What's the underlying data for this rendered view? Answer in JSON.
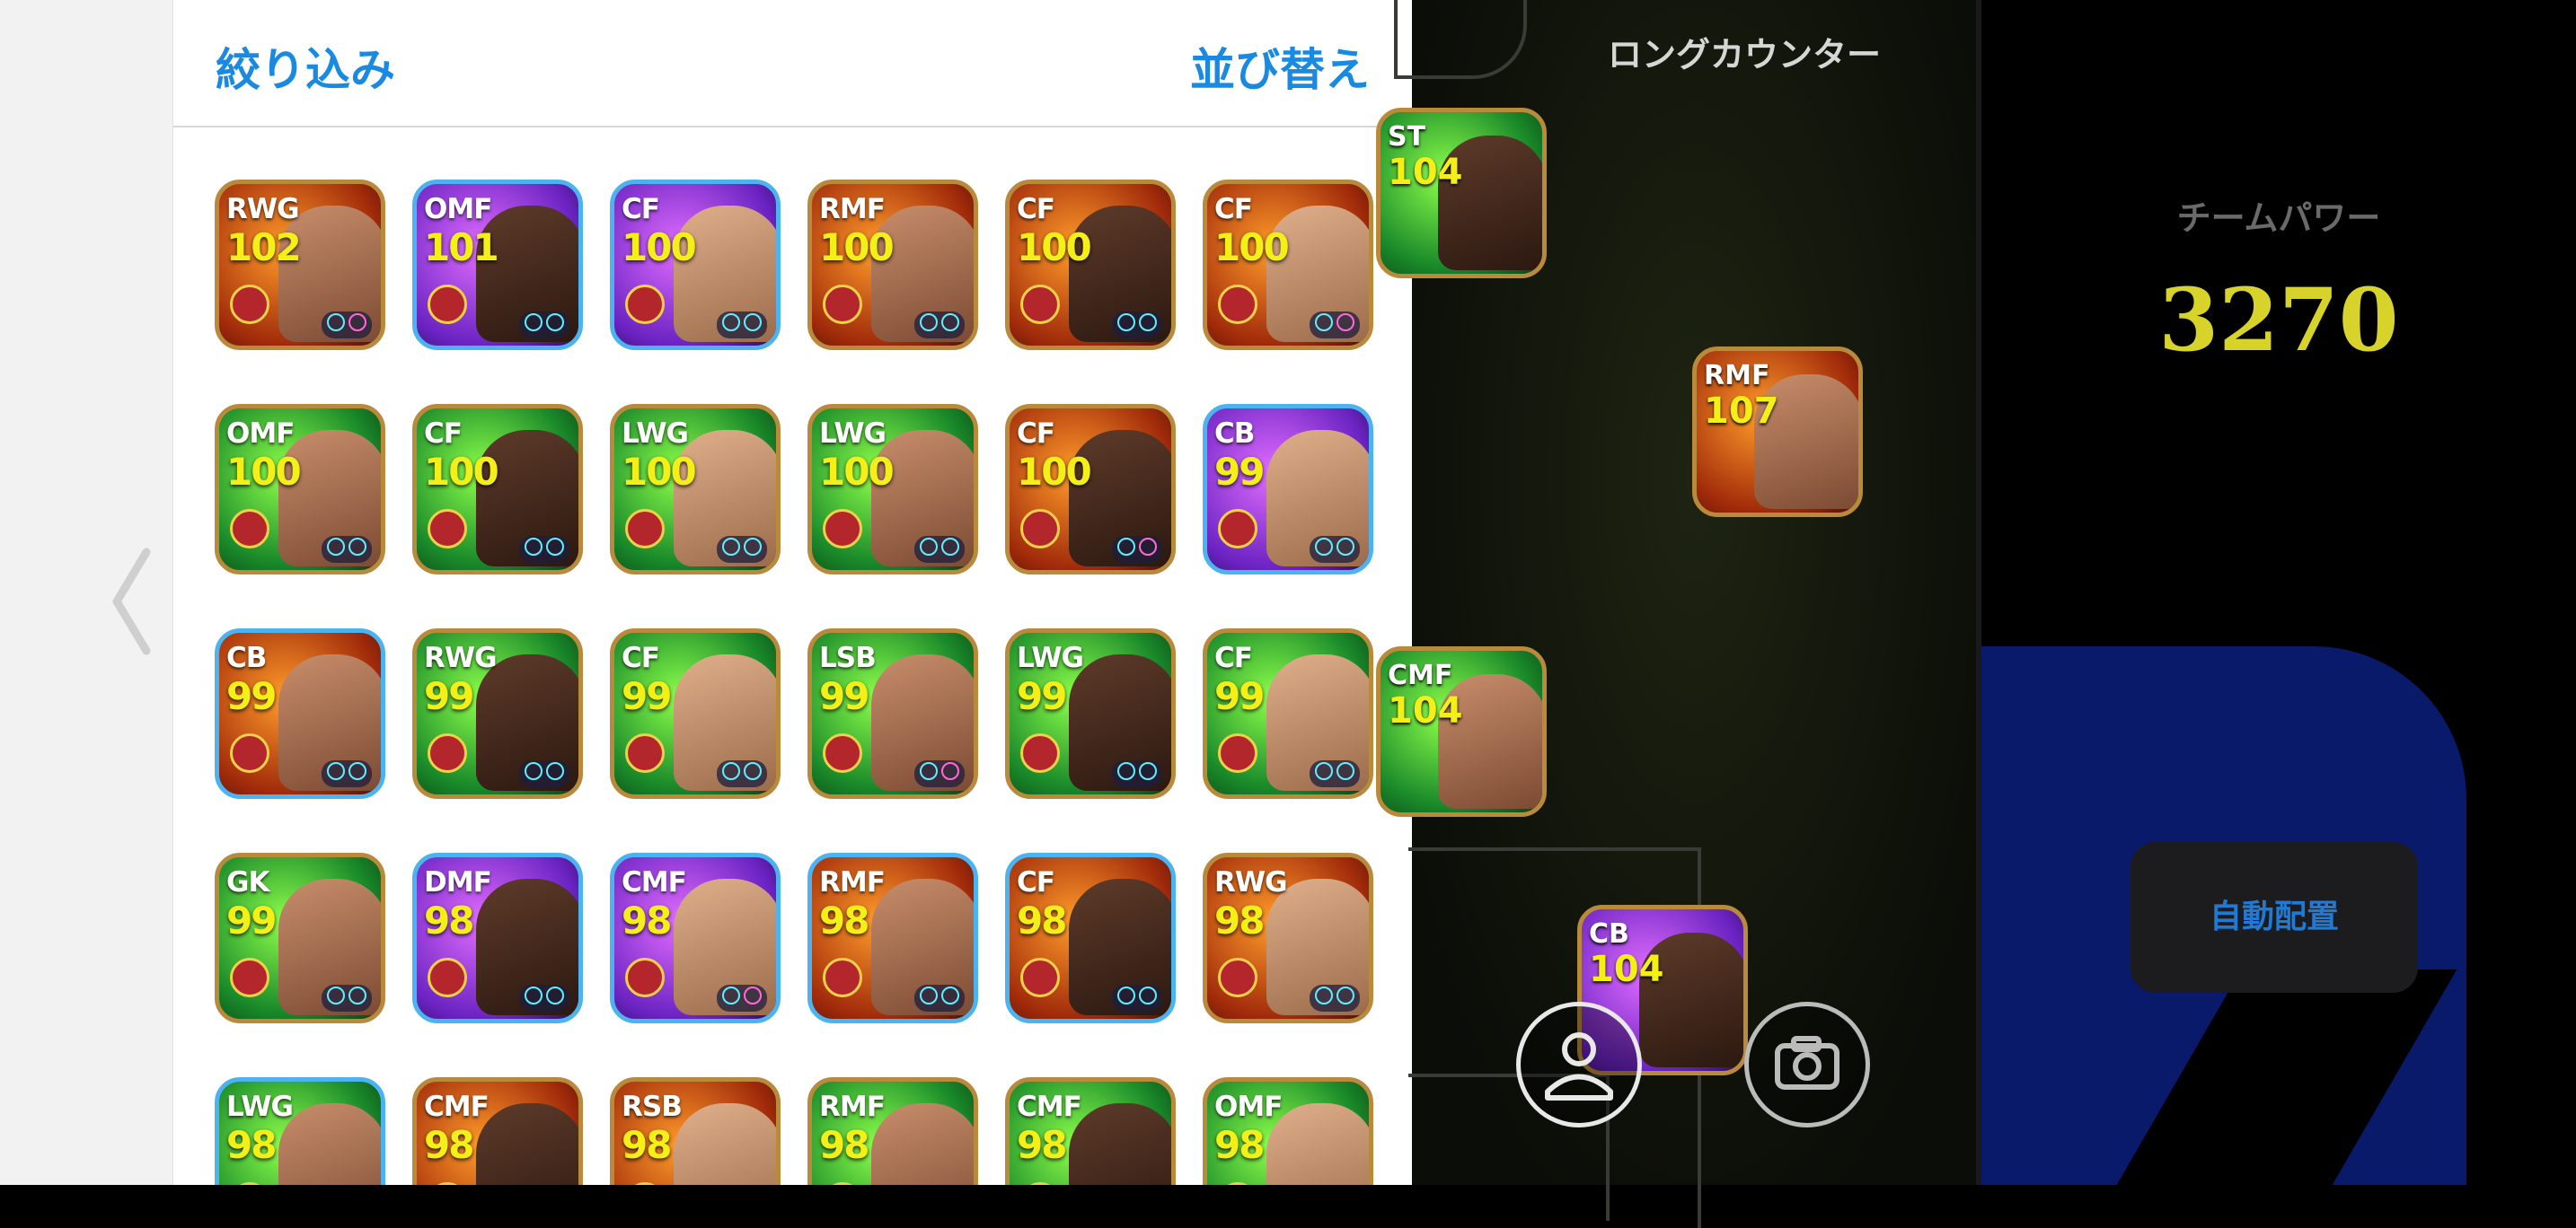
{
  "header": {
    "filter_label": "絞り込み",
    "sort_label": "並び替え"
  },
  "formation": {
    "name": "ロングカウンター"
  },
  "team_power": {
    "label": "チームパワー",
    "value": "3270"
  },
  "auto_assign_label": "自動配置",
  "colors": {
    "accent": "#1a8ae0",
    "rating": "#f4ef16",
    "team_power": "#d7d32a"
  },
  "player_cards": [
    {
      "position": "RWG",
      "rating": "102",
      "bg": "orange",
      "border": "gold"
    },
    {
      "position": "OMF",
      "rating": "101",
      "bg": "purple",
      "border": "blue"
    },
    {
      "position": "CF",
      "rating": "100",
      "bg": "purple",
      "border": "blue"
    },
    {
      "position": "RMF",
      "rating": "100",
      "bg": "orange",
      "border": "gold"
    },
    {
      "position": "CF",
      "rating": "100",
      "bg": "orange",
      "border": "gold"
    },
    {
      "position": "CF",
      "rating": "100",
      "bg": "orange",
      "border": "gold"
    },
    {
      "position": "OMF",
      "rating": "100",
      "bg": "green",
      "border": "gold"
    },
    {
      "position": "CF",
      "rating": "100",
      "bg": "green",
      "border": "gold"
    },
    {
      "position": "LWG",
      "rating": "100",
      "bg": "green",
      "border": "gold"
    },
    {
      "position": "LWG",
      "rating": "100",
      "bg": "green",
      "border": "gold"
    },
    {
      "position": "CF",
      "rating": "100",
      "bg": "orange",
      "border": "gold"
    },
    {
      "position": "CB",
      "rating": "99",
      "bg": "purple",
      "border": "blue"
    },
    {
      "position": "CB",
      "rating": "99",
      "bg": "orange",
      "border": "blue"
    },
    {
      "position": "RWG",
      "rating": "99",
      "bg": "green",
      "border": "gold"
    },
    {
      "position": "CF",
      "rating": "99",
      "bg": "green",
      "border": "gold"
    },
    {
      "position": "LSB",
      "rating": "99",
      "bg": "green",
      "border": "gold"
    },
    {
      "position": "LWG",
      "rating": "99",
      "bg": "green",
      "border": "gold"
    },
    {
      "position": "CF",
      "rating": "99",
      "bg": "green",
      "border": "gold"
    },
    {
      "position": "GK",
      "rating": "99",
      "bg": "green",
      "border": "gold"
    },
    {
      "position": "DMF",
      "rating": "98",
      "bg": "purple",
      "border": "blue"
    },
    {
      "position": "CMF",
      "rating": "98",
      "bg": "purple",
      "border": "blue"
    },
    {
      "position": "RMF",
      "rating": "98",
      "bg": "orange",
      "border": "blue"
    },
    {
      "position": "CF",
      "rating": "98",
      "bg": "orange",
      "border": "blue"
    },
    {
      "position": "RWG",
      "rating": "98",
      "bg": "orange",
      "border": "gold"
    },
    {
      "position": "LWG",
      "rating": "98",
      "bg": "green",
      "border": "blue"
    },
    {
      "position": "CMF",
      "rating": "98",
      "bg": "orange",
      "border": "gold"
    },
    {
      "position": "RSB",
      "rating": "98",
      "bg": "orange",
      "border": "gold"
    },
    {
      "position": "RMF",
      "rating": "98",
      "bg": "green",
      "border": "gold"
    },
    {
      "position": "CMF",
      "rating": "98",
      "bg": "green",
      "border": "gold"
    },
    {
      "position": "OMF",
      "rating": "98",
      "bg": "green",
      "border": "gold"
    }
  ],
  "field_players": [
    {
      "position": "ST",
      "rating": "104"
    },
    {
      "position": "RMF",
      "rating": "107"
    },
    {
      "position": "CMF",
      "rating": "104"
    },
    {
      "position": "CB",
      "rating": "104"
    }
  ],
  "icons": {
    "back": "chevron-left-icon",
    "player": "person-icon",
    "camera": "camera-icon"
  }
}
